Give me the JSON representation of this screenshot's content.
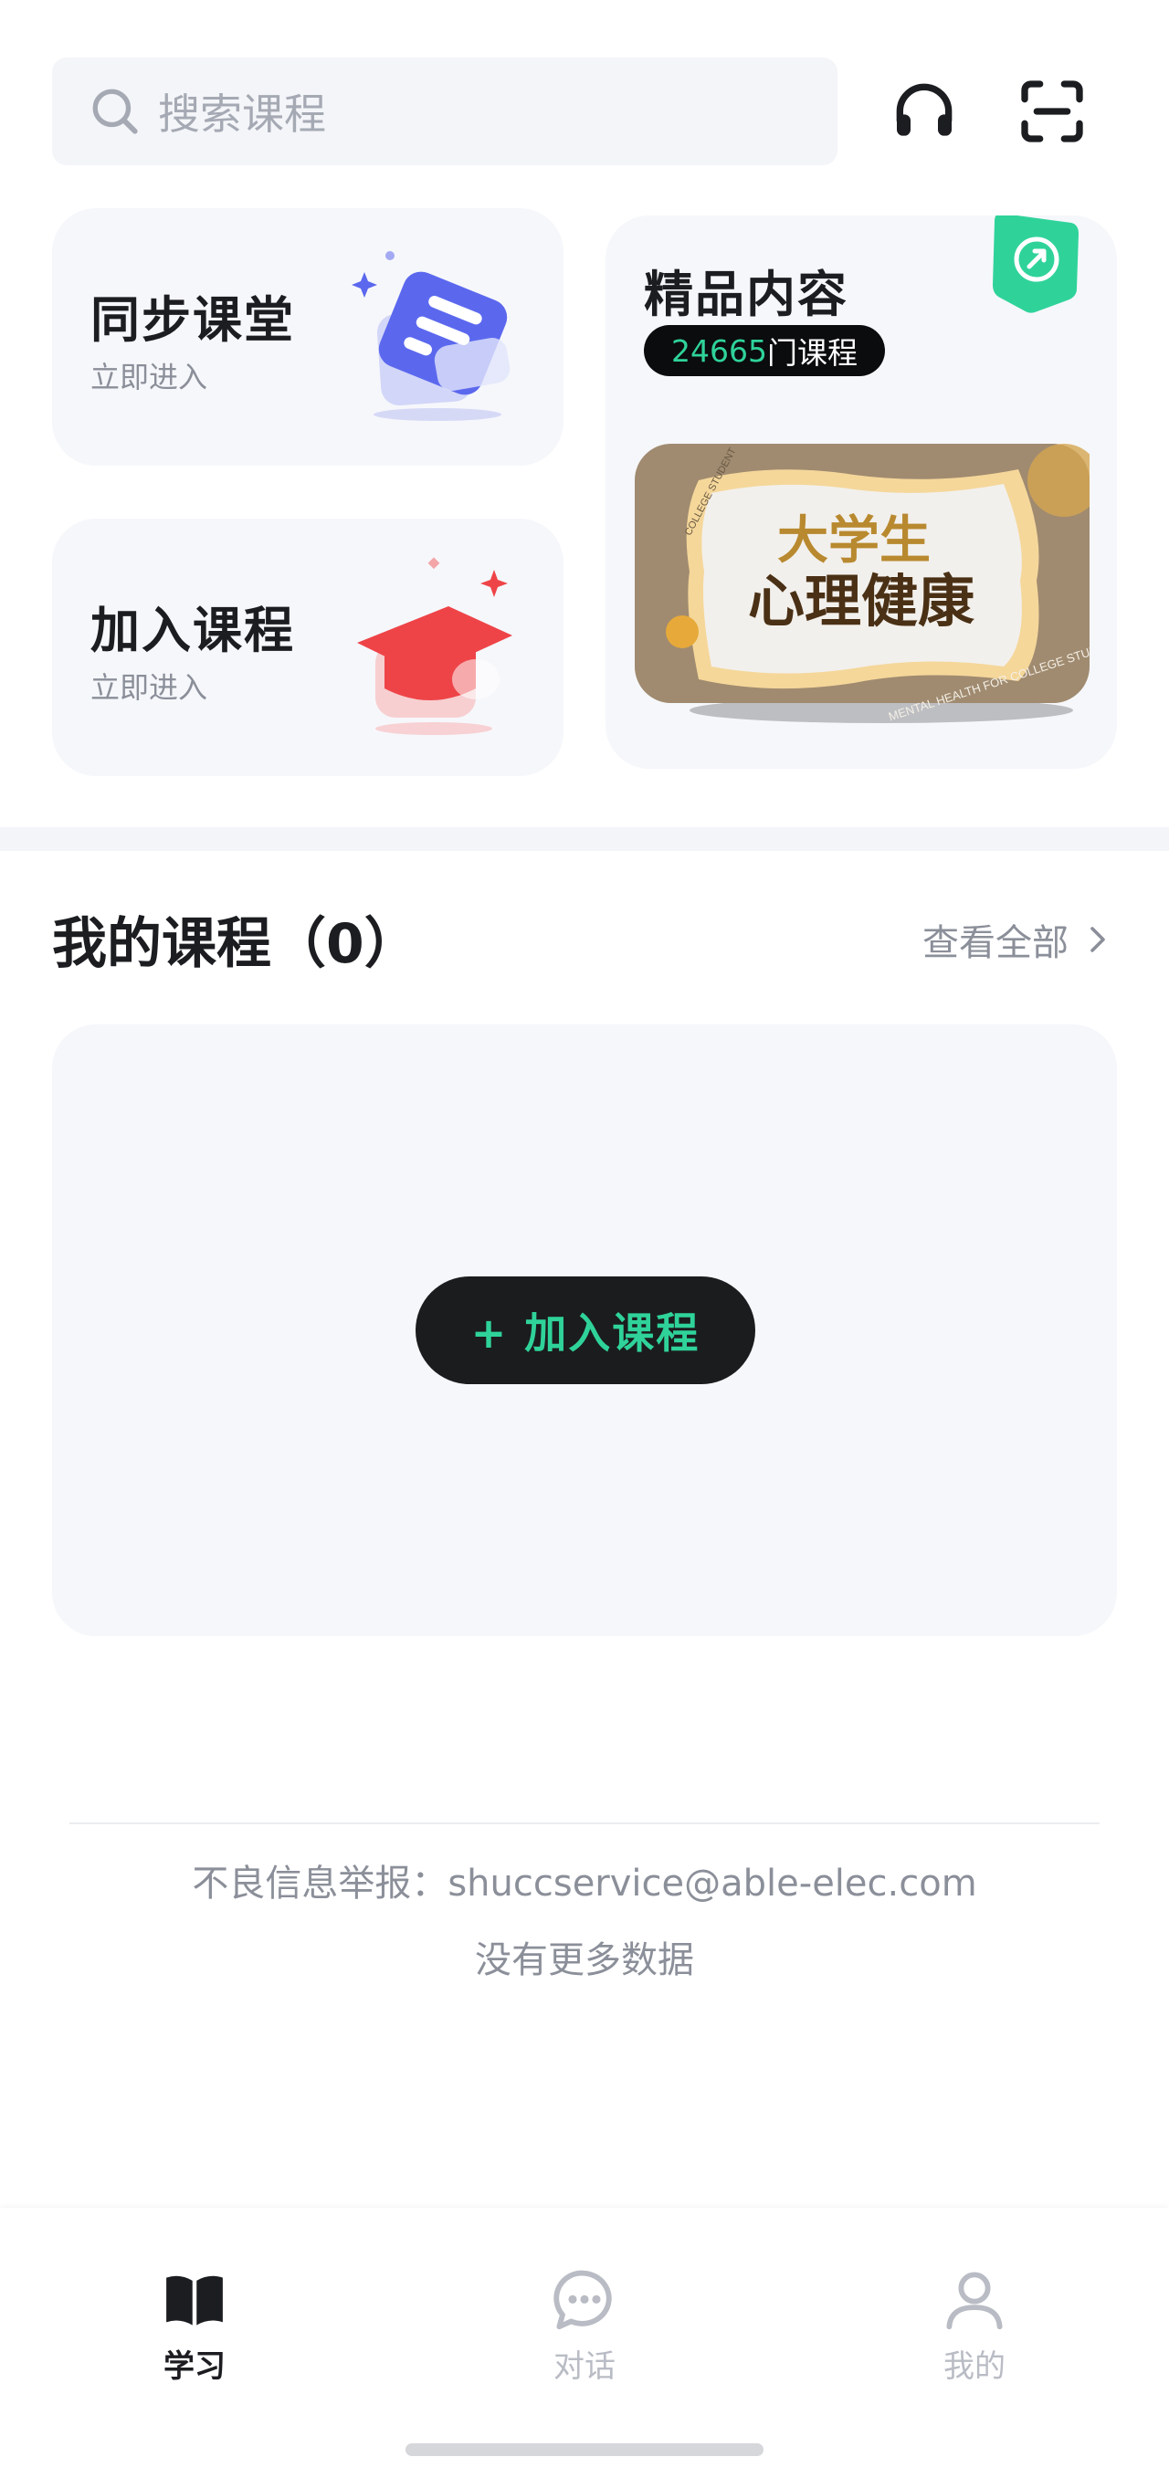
{
  "search": {
    "placeholder": "搜索课程",
    "icon": "search-icon"
  },
  "header_icons": {
    "support": "headset-icon",
    "scan": "scan-icon"
  },
  "cards": {
    "sync": {
      "title": "同步课堂",
      "subtitle": "立即进入"
    },
    "join": {
      "title": "加入课程",
      "subtitle": "立即进入"
    },
    "premium": {
      "title": "精品内容",
      "badge_count": "24665",
      "badge_suffix": "门课程",
      "cover_title_line1": "大学生",
      "cover_title_line2": "心理健康",
      "cover_arc_top": "COLLEGE STUDENT",
      "cover_arc_bottom": "MENTAL HEALTH FOR COLLEGE STUDENTS"
    }
  },
  "my_courses": {
    "title": "我的课程（0）",
    "view_all": "查看全部",
    "join_button": "+ 加入课程"
  },
  "footer": {
    "report": "不良信息举报：shuccservice@able-elec.com",
    "no_more": "没有更多数据"
  },
  "tabs": [
    {
      "label": "学习",
      "icon": "book-icon",
      "active": true
    },
    {
      "label": "对话",
      "icon": "chat-bubble-icon",
      "active": false
    },
    {
      "label": "我的",
      "icon": "user-icon",
      "active": false
    }
  ],
  "colors": {
    "accent": "#2fd39a",
    "card_bg": "#f6f7fb",
    "dark": "#1b1c1e",
    "muted": "#8b8f99"
  }
}
